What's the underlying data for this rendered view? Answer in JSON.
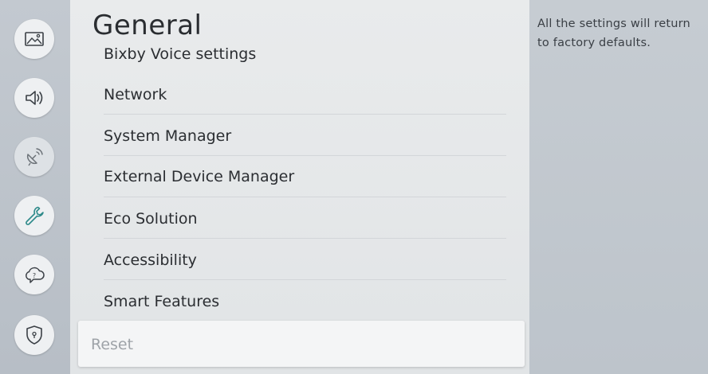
{
  "page": {
    "title": "General"
  },
  "sidebar": {
    "items": [
      {
        "id": "picture",
        "icon": "picture-icon"
      },
      {
        "id": "sound",
        "icon": "speaker-icon"
      },
      {
        "id": "broadcasting",
        "icon": "satellite-dish-icon"
      },
      {
        "id": "general",
        "icon": "wrench-icon",
        "selected": true
      },
      {
        "id": "support",
        "icon": "help-cloud-icon"
      },
      {
        "id": "privacy",
        "icon": "shield-icon"
      }
    ]
  },
  "menu": {
    "partial_item": "Bixby Voice settings",
    "items": [
      "Network",
      "System Manager",
      "External Device Manager",
      "Eco Solution",
      "Accessibility",
      "Smart Features"
    ],
    "focused_item": "Reset"
  },
  "info": {
    "description": "All the settings will return to factory defaults."
  }
}
